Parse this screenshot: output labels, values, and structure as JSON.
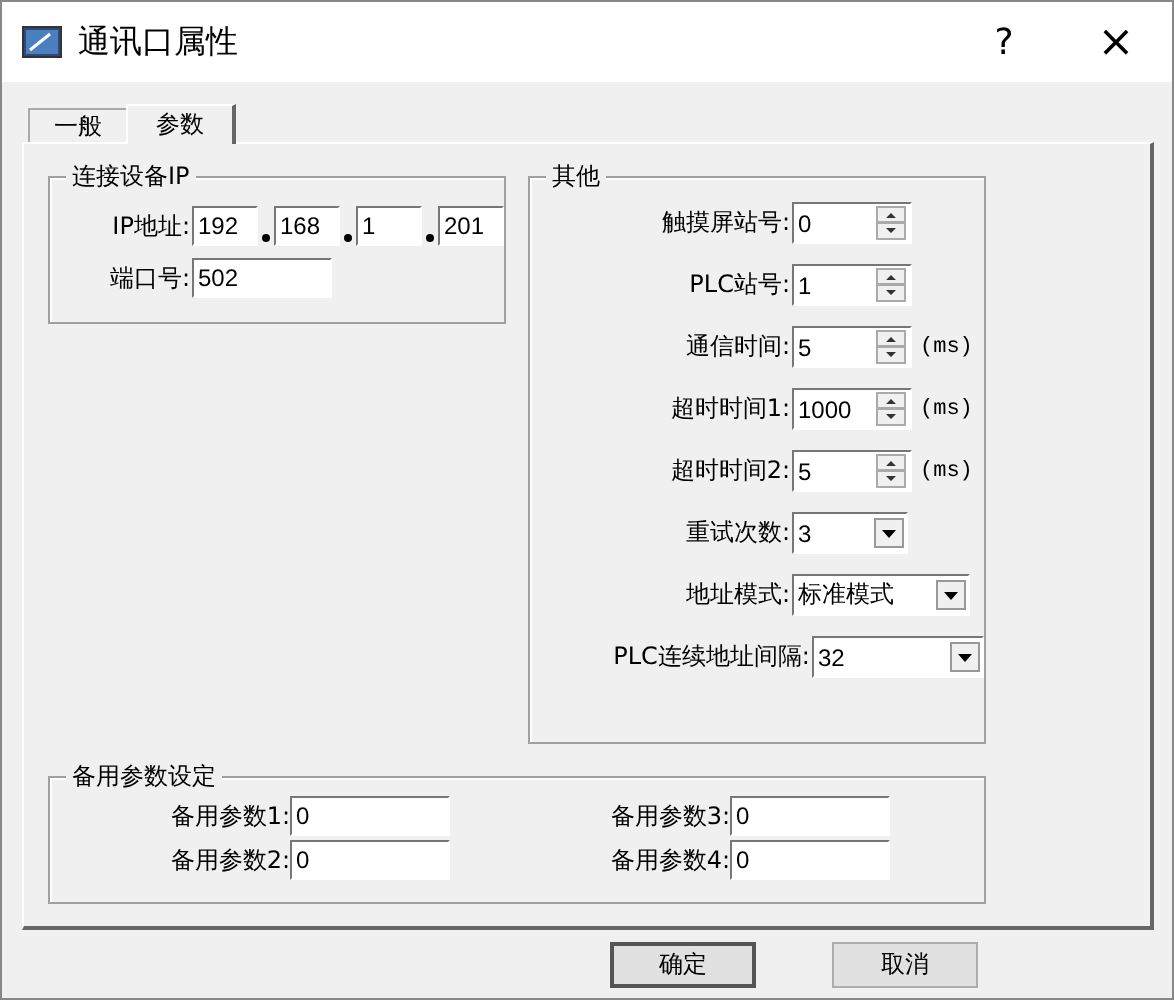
{
  "window": {
    "title": "通讯口属性",
    "help": "?",
    "close": "×"
  },
  "tabs": [
    {
      "label": "一般",
      "selected": false
    },
    {
      "label": "参数",
      "selected": true
    }
  ],
  "device_ip": {
    "title": "连接设备IP",
    "ip_label": "IP地址:",
    "ip_parts": [
      "192",
      "168",
      "1",
      "201"
    ],
    "port_label": "端口号:",
    "port": "502"
  },
  "other": {
    "title": "其他",
    "rows": [
      {
        "kind": "spin",
        "label": "触摸屏站号:",
        "value": "0"
      },
      {
        "kind": "spin",
        "label": "PLC站号:",
        "value": "1"
      },
      {
        "kind": "spin",
        "label": "通信时间:",
        "value": "5",
        "unit": "(ms)"
      },
      {
        "kind": "spin",
        "label": "超时时间1:",
        "value": "1000",
        "unit": "(ms)"
      },
      {
        "kind": "spin",
        "label": "超时时间2:",
        "value": "5",
        "unit": "(ms)"
      },
      {
        "kind": "combo",
        "label": "重试次数:",
        "value": "3",
        "wide": false
      },
      {
        "kind": "combo",
        "label": "地址模式:",
        "value": "标准模式",
        "wide": true
      },
      {
        "kind": "combo",
        "label": "PLC连续地址间隔:",
        "value": "32",
        "wide": true
      }
    ]
  },
  "backup": {
    "title": "备用参数设定",
    "fields": [
      {
        "label": "备用参数1:",
        "value": "0"
      },
      {
        "label": "备用参数3:",
        "value": "0"
      },
      {
        "label": "备用参数2:",
        "value": "0"
      },
      {
        "label": "备用参数4:",
        "value": "0"
      }
    ]
  },
  "buttons": [
    {
      "label": "确定",
      "default": true
    },
    {
      "label": "取消",
      "default": false
    }
  ]
}
